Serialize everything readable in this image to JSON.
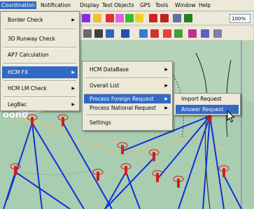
{
  "menubar": [
    "Coordination",
    "Notification",
    "Display",
    "Test Objects",
    "GPS",
    "Tools",
    "Window",
    "Help"
  ],
  "zoom": "100%",
  "coordination_menu": [
    {
      "label": "Border Check",
      "arrow": true
    },
    {
      "label": "3D Runway Check",
      "arrow": false
    },
    {
      "label": "AP7 Calculation",
      "arrow": false
    },
    {
      "label": "HCM FX",
      "arrow": true
    },
    {
      "label": "HCM LM Check",
      "arrow": true
    },
    {
      "label": "LegBac",
      "arrow": true
    }
  ],
  "hcm_fx_menu": [
    {
      "label": "HCM DataBase",
      "arrow": true
    },
    {
      "label": "Overall List",
      "arrow": true
    },
    {
      "label": "Process Foreign Request",
      "arrow": true
    },
    {
      "label": "Process National Request",
      "arrow": true
    },
    {
      "label": "Settings",
      "arrow": false
    }
  ],
  "foreign_request_menu": [
    {
      "label": "Import Request"
    },
    {
      "label": "Answer Request"
    }
  ],
  "colors": {
    "highlight": "#316ac5",
    "map_bg": "#b5d3b8",
    "link": "#1030d8",
    "antenna": "#d41a1a"
  }
}
